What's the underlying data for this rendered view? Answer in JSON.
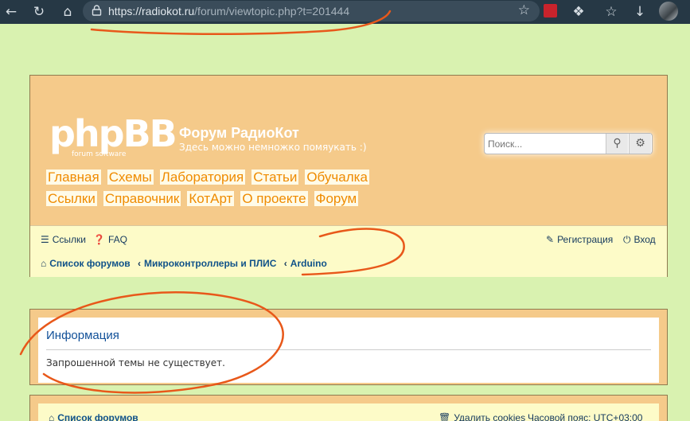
{
  "browser": {
    "url_host": "https://radiokot.ru",
    "url_path": "/forum/viewtopic.php?t=201444"
  },
  "header": {
    "logo_main": "phpBB",
    "logo_sub": "forum software",
    "site_title": "Форум РадиоКот",
    "site_desc": "Здесь можно немножко помяукать :)",
    "search_placeholder": "Поиск...",
    "nav_row1": [
      "Главная",
      "Схемы",
      "Лаборатория",
      "Статьи",
      "Обучалка"
    ],
    "nav_row2": [
      "Ссылки",
      "Справочник",
      "КотАрт",
      "О проекте",
      "Форум"
    ]
  },
  "navbar": {
    "faq_prefix": "Ссылки",
    "faq": "FAQ",
    "register": "Регистрация",
    "login": "Вход",
    "breadcrumbs": [
      "Список форумов",
      "Микроконтроллеры и ПЛИС",
      "Arduino"
    ]
  },
  "info": {
    "title": "Информация",
    "message": "Запрошенной темы не существует."
  },
  "footer": {
    "board_index": "Список форумов",
    "delete_cookies": "Удалить cookies",
    "timezone": "Часовой пояс: UTC+03:00"
  },
  "colors": {
    "header_bg": "#f5ca8a",
    "navbar_bg": "#fdfbc8",
    "page_bg": "#d9f2b0",
    "annotation": "#e8581a"
  }
}
